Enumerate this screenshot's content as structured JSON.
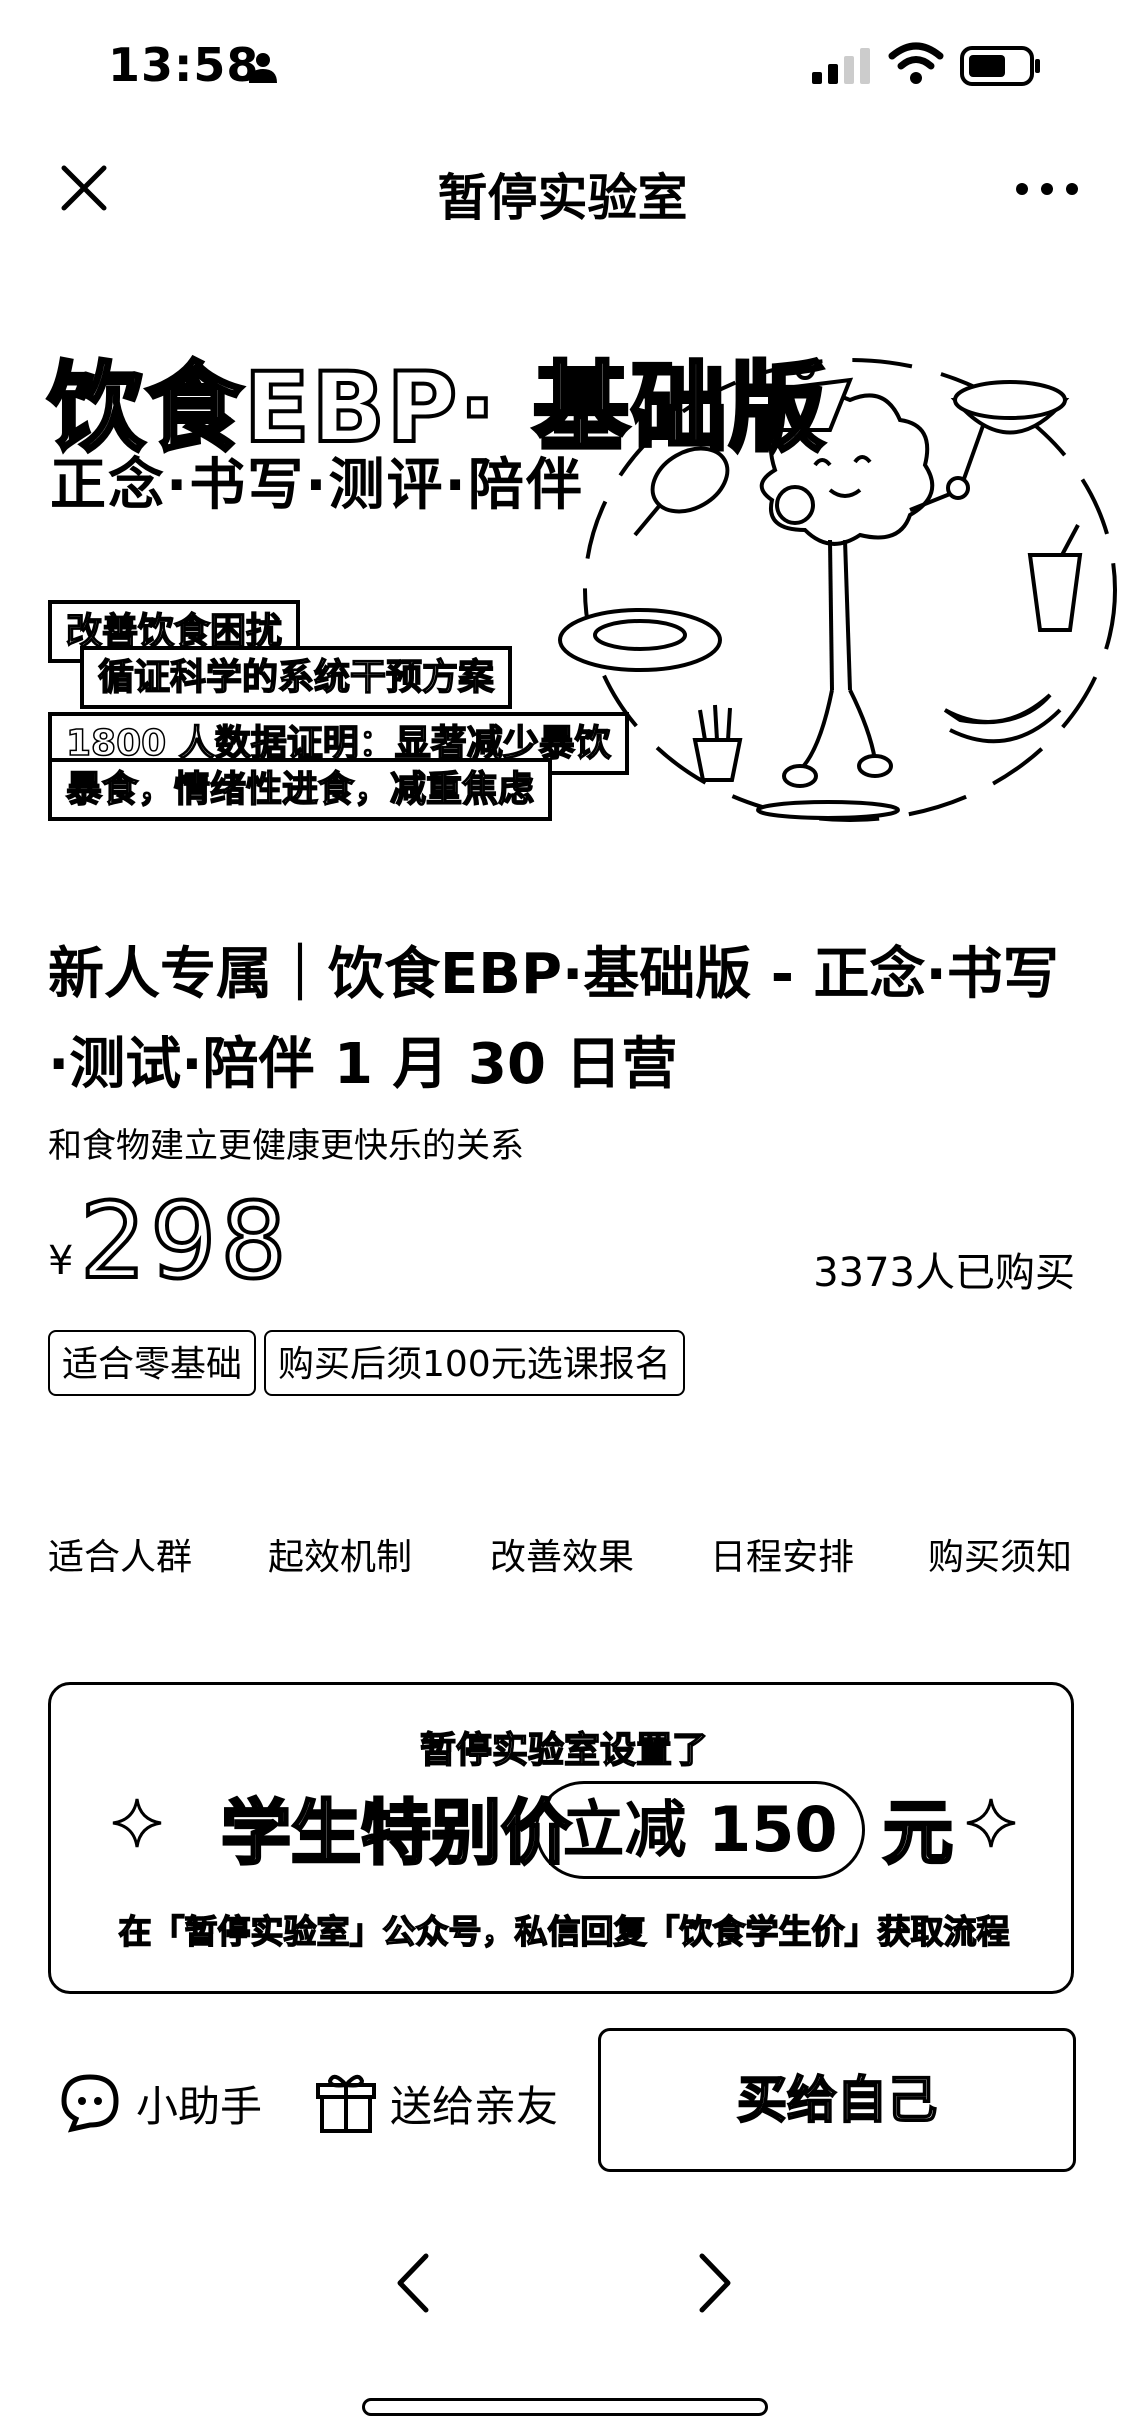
{
  "status_bar": {
    "time": "13:58"
  },
  "nav": {
    "title": "暂停实验室"
  },
  "banner": {
    "title": "饮食EBP· 基础版",
    "subtitle": "正念·书写·测评·陪伴",
    "bullet1_line1": "改善饮食困扰",
    "bullet1_line2": "循证科学的系统干预方案",
    "bullet2_line1": "1800 人数据证明：显著减少暴饮",
    "bullet2_line2": "暴食，情绪性进食，减重焦虑"
  },
  "product": {
    "title": "新人专属｜饮食EBP·基础版 - 正念·书写·测试·陪伴 1 月 30 日营",
    "subtitle": "和食物建立更健康更快乐的关系",
    "currency": "¥",
    "price": "298",
    "sold": "3373人已购买",
    "tags": [
      "适合零基础",
      "购买后须100元选课报名"
    ]
  },
  "section_tabs": [
    "适合人群",
    "起效机制",
    "改善效果",
    "日程安排",
    "购买须知"
  ],
  "promo": {
    "header": "暂停实验室设置了",
    "main": "学生特别价",
    "discount": "立减 150",
    "unit": "元",
    "footer": "在「暂停实验室」公众号，私信回复「饮食学生价」获取流程"
  },
  "actions": {
    "assistant": "小助手",
    "gift": "送给亲友",
    "buy": "买给自己"
  }
}
